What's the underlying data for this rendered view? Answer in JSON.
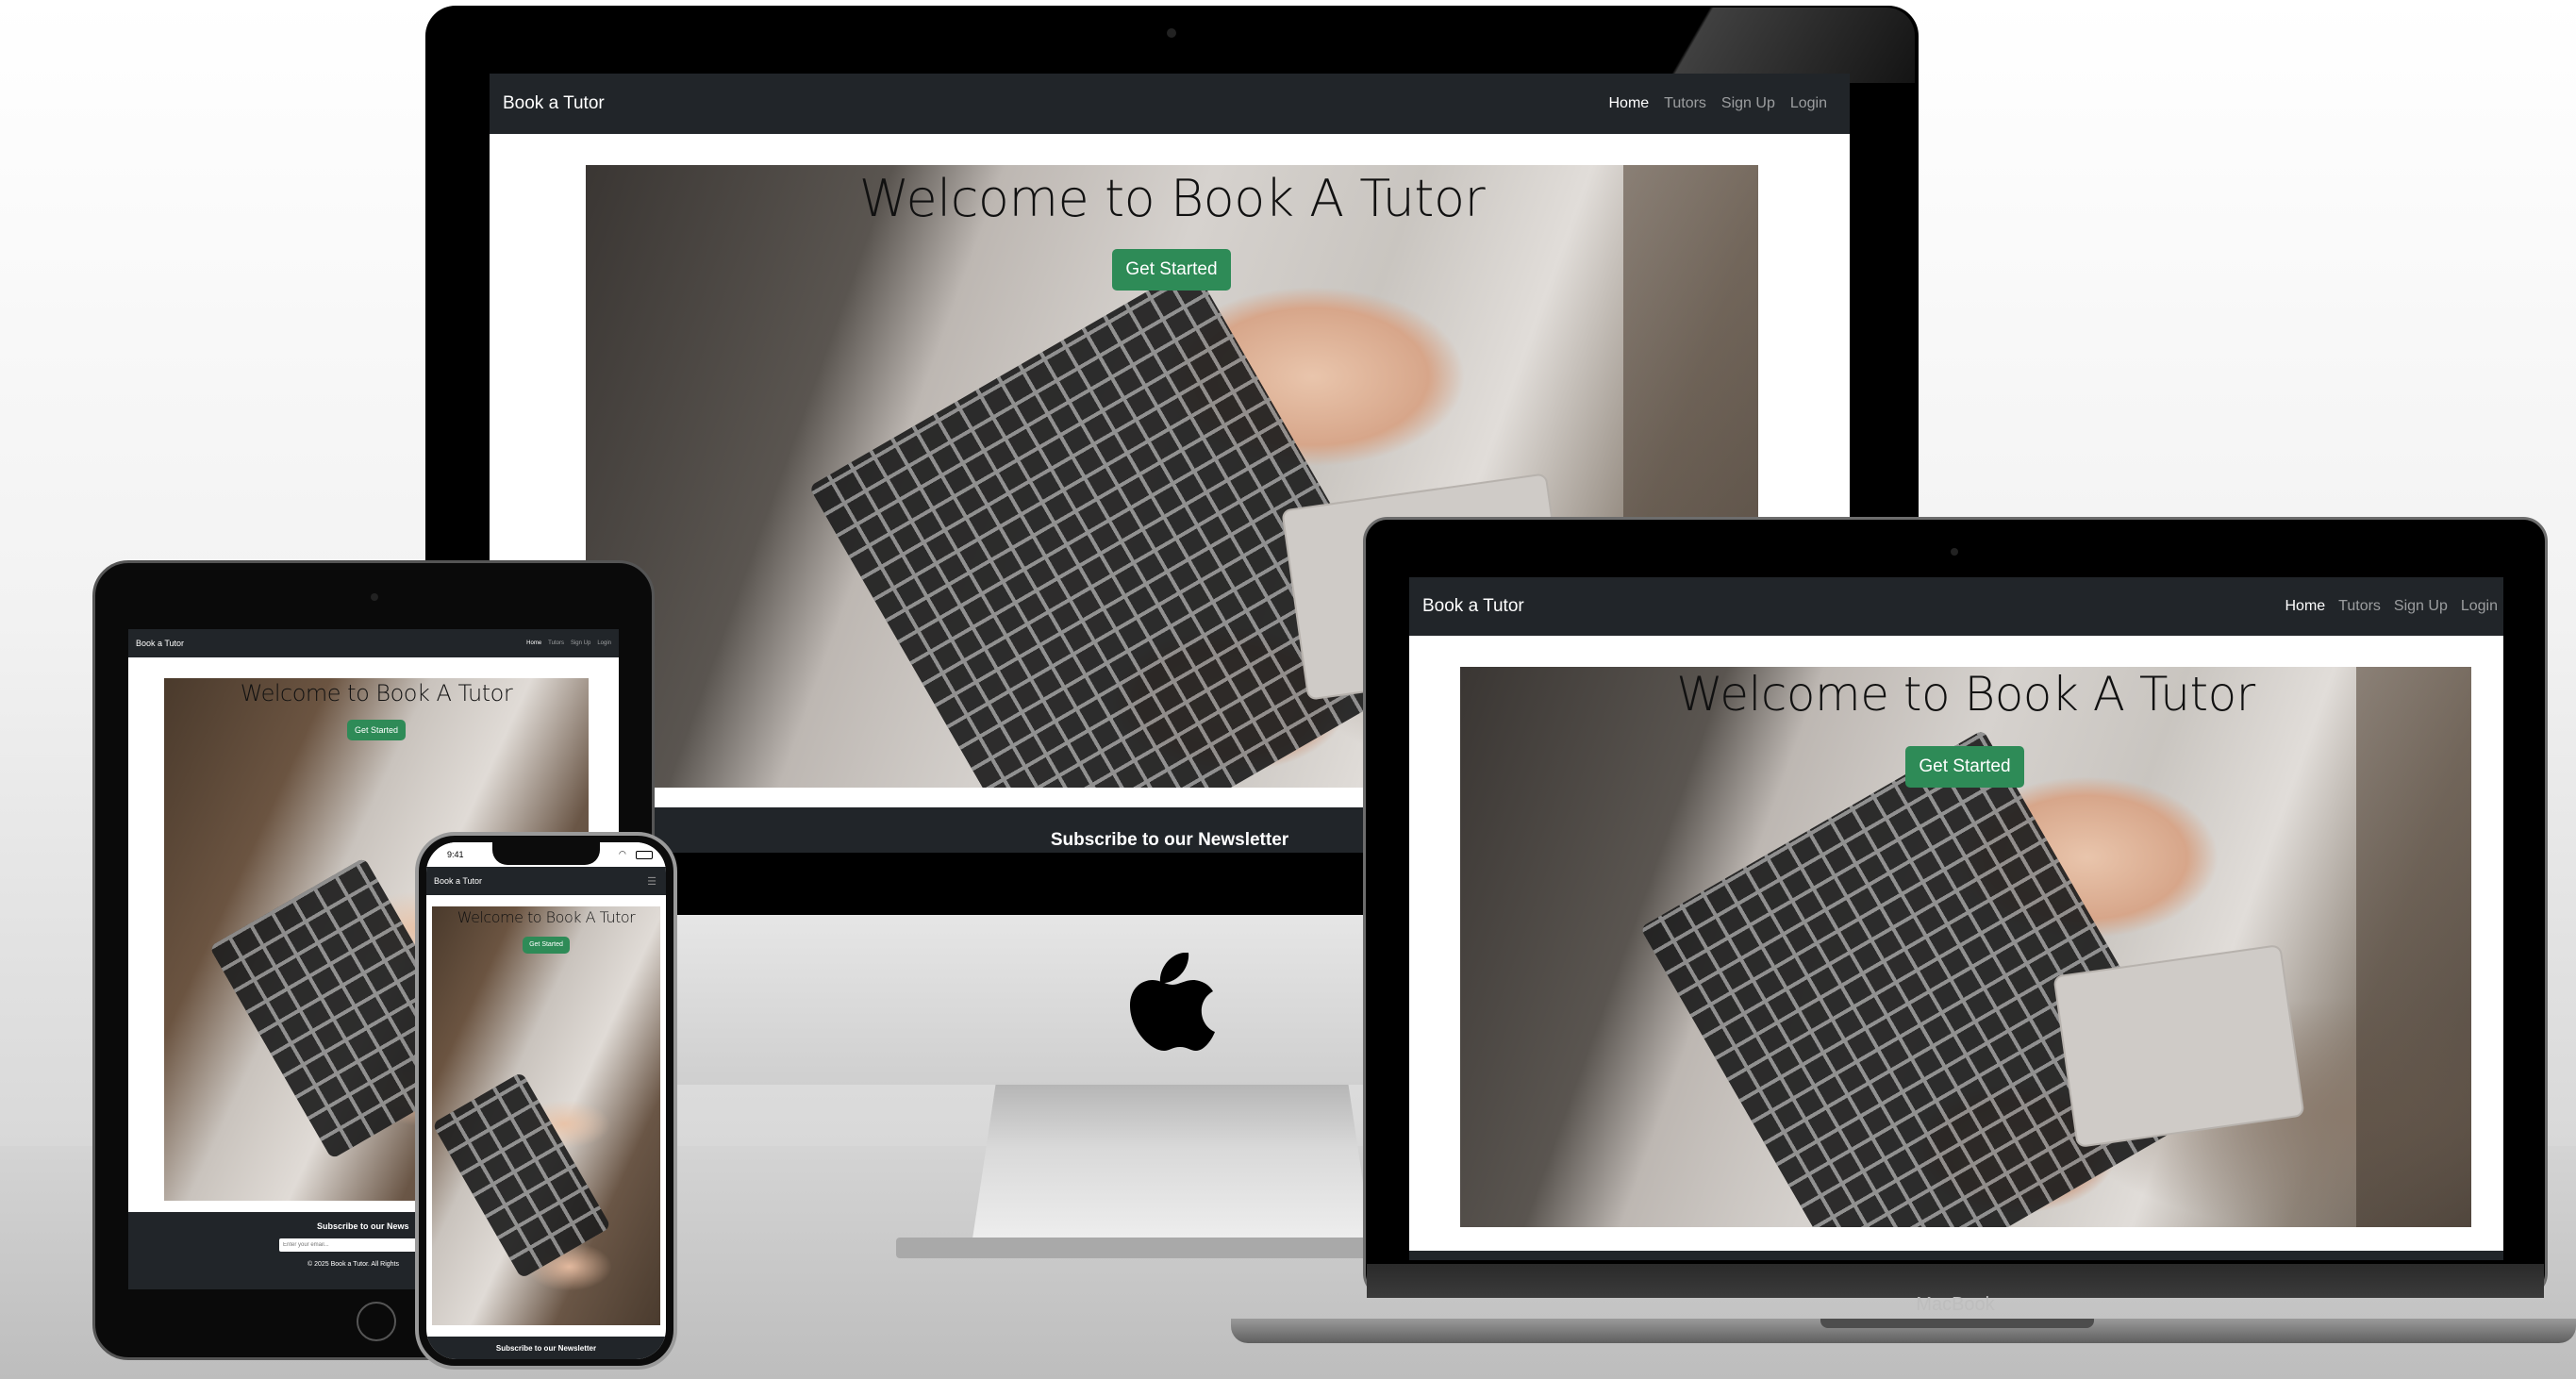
{
  "site": {
    "brand": "Book a Tutor",
    "nav": [
      "Home",
      "Tutors",
      "Sign Up",
      "Login"
    ],
    "hero_title": "Welcome to Book A Tutor",
    "cta": "Get Started",
    "newsletter_title": "Subscribe to our Newsletter",
    "newsletter_title_short": "Subscribe to our News",
    "email_placeholder": "Enter your email...",
    "footer_copy": "© 2025 Book a Tutor. All Rights"
  },
  "devices": {
    "laptop_label": "MacBook",
    "phone_time": "9:41"
  },
  "colors": {
    "navbar": "#212529",
    "cta": "#2e8b57",
    "nav_link": "rgba(255,255,255,0.55)"
  }
}
